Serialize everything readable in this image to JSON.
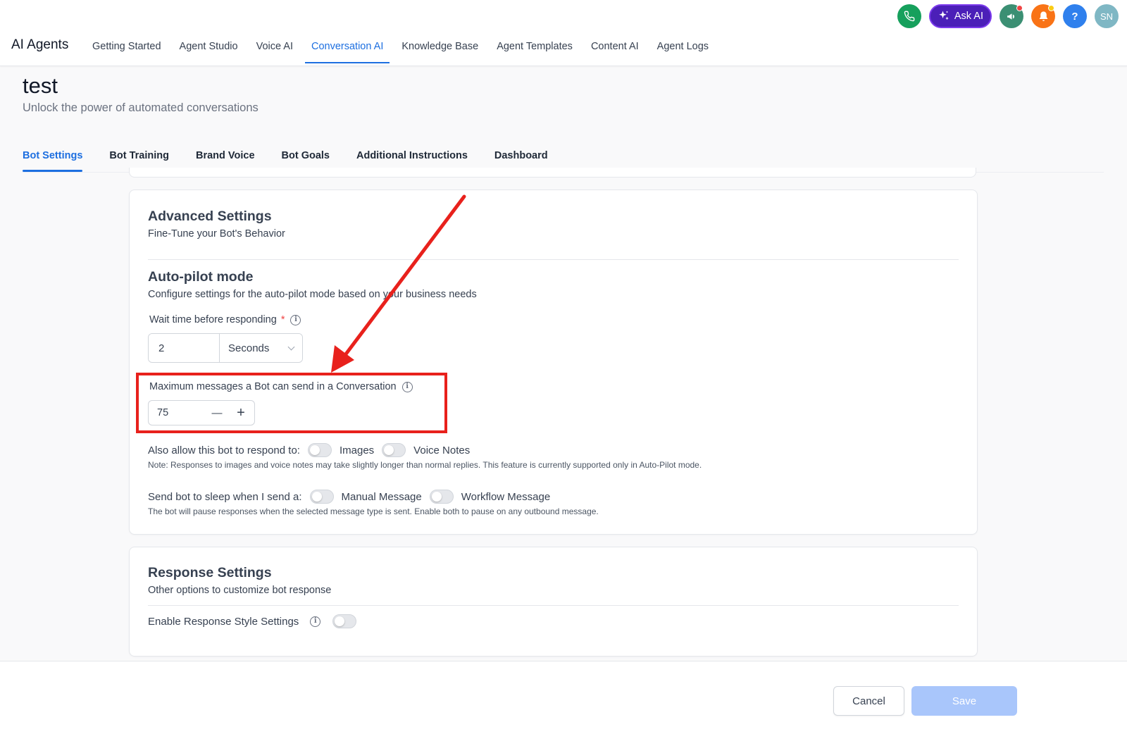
{
  "app": {
    "title": "AI Agents",
    "nav_tabs": [
      {
        "label": "Getting Started"
      },
      {
        "label": "Agent Studio"
      },
      {
        "label": "Voice AI"
      },
      {
        "label": "Conversation AI"
      },
      {
        "label": "Knowledge Base"
      },
      {
        "label": "Agent Templates"
      },
      {
        "label": "Content AI"
      },
      {
        "label": "Agent Logs"
      }
    ],
    "active_nav_tab": "Conversation AI",
    "header_icons": {
      "phone_icon": "phone-icon",
      "ask_ai_label": "Ask AI",
      "ask_ai_icon": "sparkle-icon",
      "announcement_icon": "megaphone-icon",
      "notification_icon": "bell-icon",
      "help_label": "?",
      "avatar_initials": "SN"
    }
  },
  "page": {
    "title": "test",
    "subtitle": "Unlock the power of automated conversations"
  },
  "sub_tabs": [
    {
      "label": "Bot Settings"
    },
    {
      "label": "Bot Training"
    },
    {
      "label": "Brand Voice"
    },
    {
      "label": "Bot Goals"
    },
    {
      "label": "Additional Instructions"
    },
    {
      "label": "Dashboard"
    }
  ],
  "active_sub_tab": "Bot Settings",
  "advanced_settings": {
    "title": "Advanced Settings",
    "subtitle": "Fine-Tune your Bot's Behavior",
    "autopilot": {
      "title": "Auto-pilot mode",
      "subtitle": "Configure settings for the auto-pilot mode based on your business needs",
      "wait_time_label": "Wait time before responding",
      "required_mark": "*",
      "wait_time_value": "2",
      "wait_time_unit": "Seconds",
      "max_messages_label": "Maximum messages a Bot can send in a Conversation",
      "max_messages_value": "75",
      "decrement": "—",
      "increment": "+"
    },
    "respond_to": {
      "label": "Also allow this bot to respond to:",
      "options": [
        {
          "label": "Images",
          "enabled": false
        },
        {
          "label": "Voice Notes",
          "enabled": false
        }
      ],
      "note": "Note: Responses to images and voice notes may take slightly longer than normal replies. This feature is currently supported only in Auto-Pilot mode."
    },
    "sleep": {
      "label": "Send bot to sleep when I send a:",
      "options": [
        {
          "label": "Manual Message",
          "enabled": false
        },
        {
          "label": "Workflow Message",
          "enabled": false
        }
      ],
      "note": "The bot will pause responses when the selected message type is sent. Enable both to pause on any outbound message."
    }
  },
  "response_settings": {
    "title": "Response Settings",
    "subtitle": "Other options to customize bot response",
    "enable_style_label": "Enable Response Style Settings",
    "enable_style_enabled": false
  },
  "footer": {
    "cancel_label": "Cancel",
    "save_label": "Save"
  },
  "annotation": {
    "highlight_color": "#e8211c"
  },
  "colors": {
    "accent": "#1d6fe0",
    "save_disabled": "#a9c6fb"
  }
}
